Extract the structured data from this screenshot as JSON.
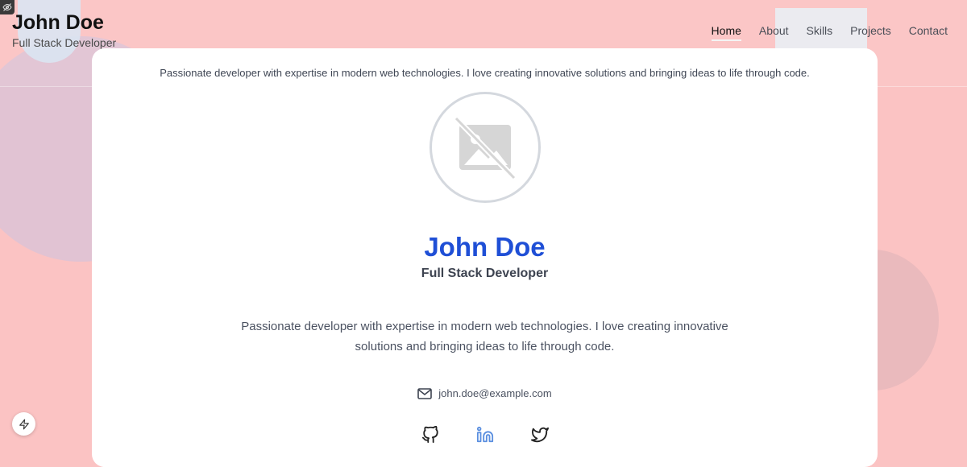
{
  "header": {
    "name": "John Doe",
    "role": "Full Stack Developer",
    "nav": [
      {
        "label": "Home",
        "active": true
      },
      {
        "label": "About"
      },
      {
        "label": "Skills"
      },
      {
        "label": "Projects"
      },
      {
        "label": "Contact"
      }
    ]
  },
  "card": {
    "intro": "Passionate developer with expertise in modern web technologies. I love creating innovative solutions and bringing ideas to life through code.",
    "name": "John Doe",
    "role": "Full Stack Developer",
    "bio": "Passionate developer with expertise in modern web technologies. I love creating innovative solutions and bringing ideas to life through code.",
    "email": "john.doe@example.com",
    "socials": [
      "github-icon",
      "linkedin-icon",
      "twitter-icon"
    ]
  },
  "colors": {
    "background": "#fbc3c3",
    "accent": "#1f4fd6",
    "linkedin": "#5b8fe0"
  }
}
